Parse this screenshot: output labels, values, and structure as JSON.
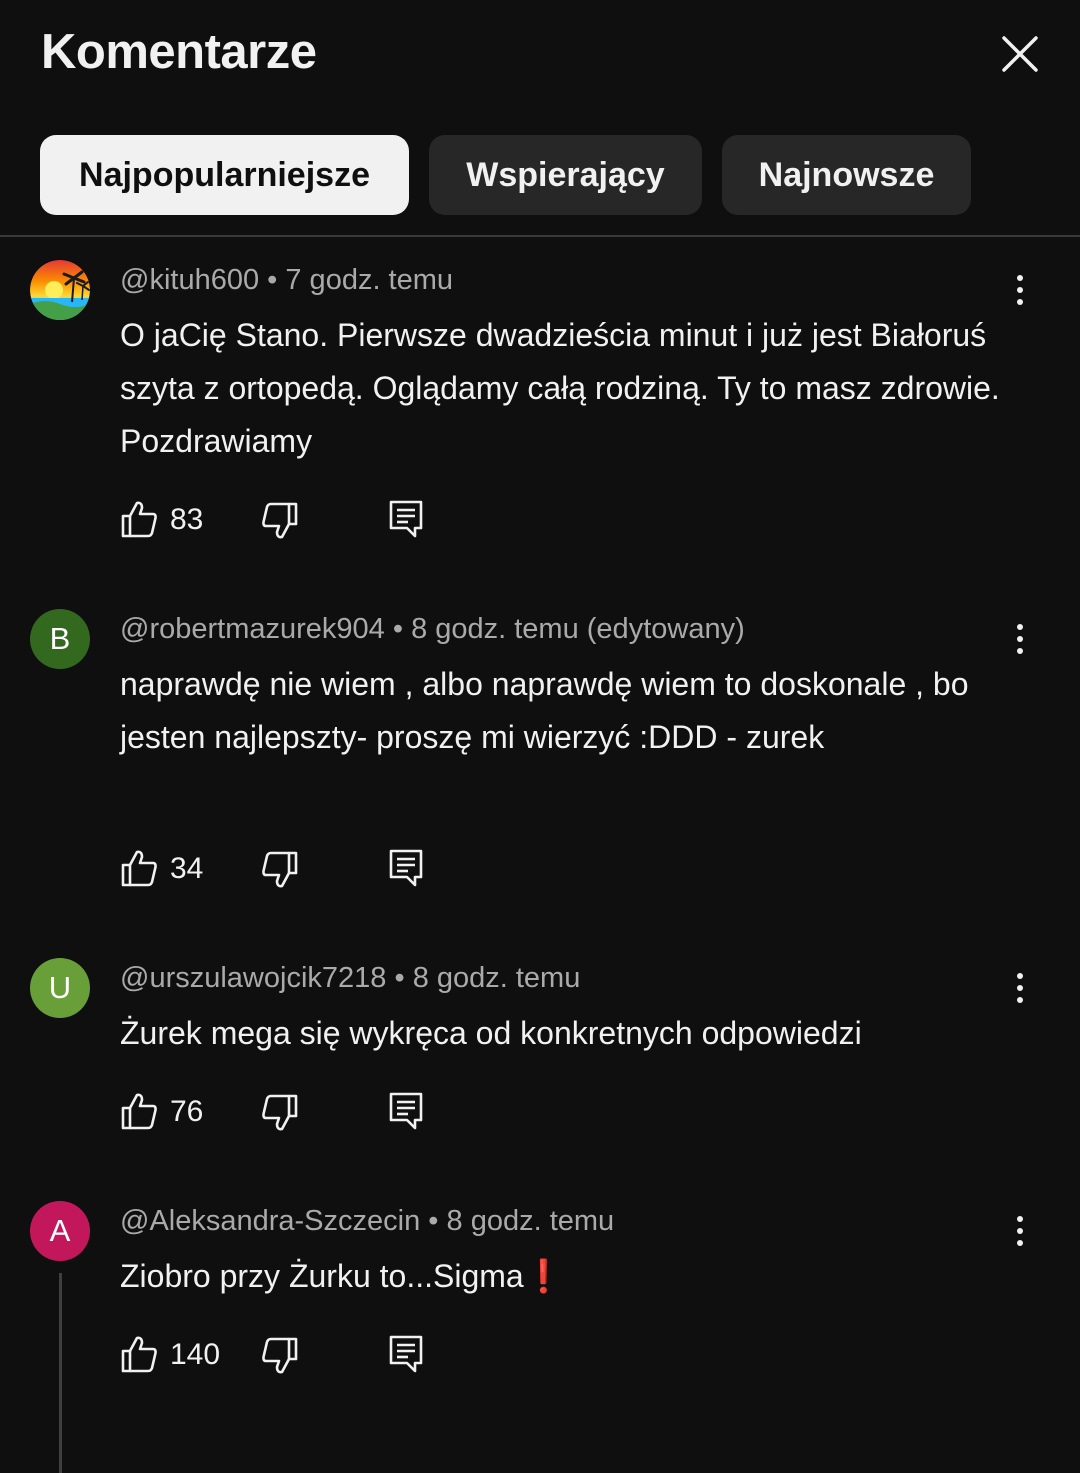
{
  "header": {
    "title": "Komentarze",
    "close_icon": "close-icon"
  },
  "tabs": [
    {
      "label": "Najpopularniejsze",
      "active": true
    },
    {
      "label": "Wspierający",
      "active": false
    },
    {
      "label": "Najnowsze",
      "active": false
    }
  ],
  "colors": {
    "background": "#0f0f0f",
    "chip_active": "#f1f1f1",
    "chip_inactive": "#272727",
    "meta_text": "#aaaaaa"
  },
  "comments": [
    {
      "author": "@kituh600",
      "time": "7 godz. temu",
      "avatar": "tropical-sunset-avatar",
      "text": "O jaCię Stano. Pierwsze dwadzieścia minut i już jest Białoruś szyta z ortopedą. Oglądamy całą rodziną. Ty to masz zdrowie. Pozdrawiamy",
      "likes": "83"
    },
    {
      "author": "@robertmazurek904",
      "time": "8 godz. temu (edytowany)",
      "avatar_letter": "B",
      "avatar_color": "#33691e",
      "text": "naprawdę nie wiem , albo naprawdę wiem to doskonale , bo jesten najlepszty- proszę mi wierzyć :DDD  - zurek",
      "likes": "34"
    },
    {
      "author": "@urszulawojcik7218",
      "time": "8 godz. temu",
      "avatar_letter": "U",
      "avatar_color": "#689f38",
      "text": "Żurek mega się wykręca od konkretnych odpowiedzi",
      "likes": "76"
    },
    {
      "author": "@Aleksandra-Szczecin",
      "time": "8 godz. temu",
      "avatar_letter": "A",
      "avatar_color": "#c2185b",
      "text": "Ziobro przy Żurku to...Sigma❗",
      "likes": "140"
    }
  ],
  "separator": "•"
}
